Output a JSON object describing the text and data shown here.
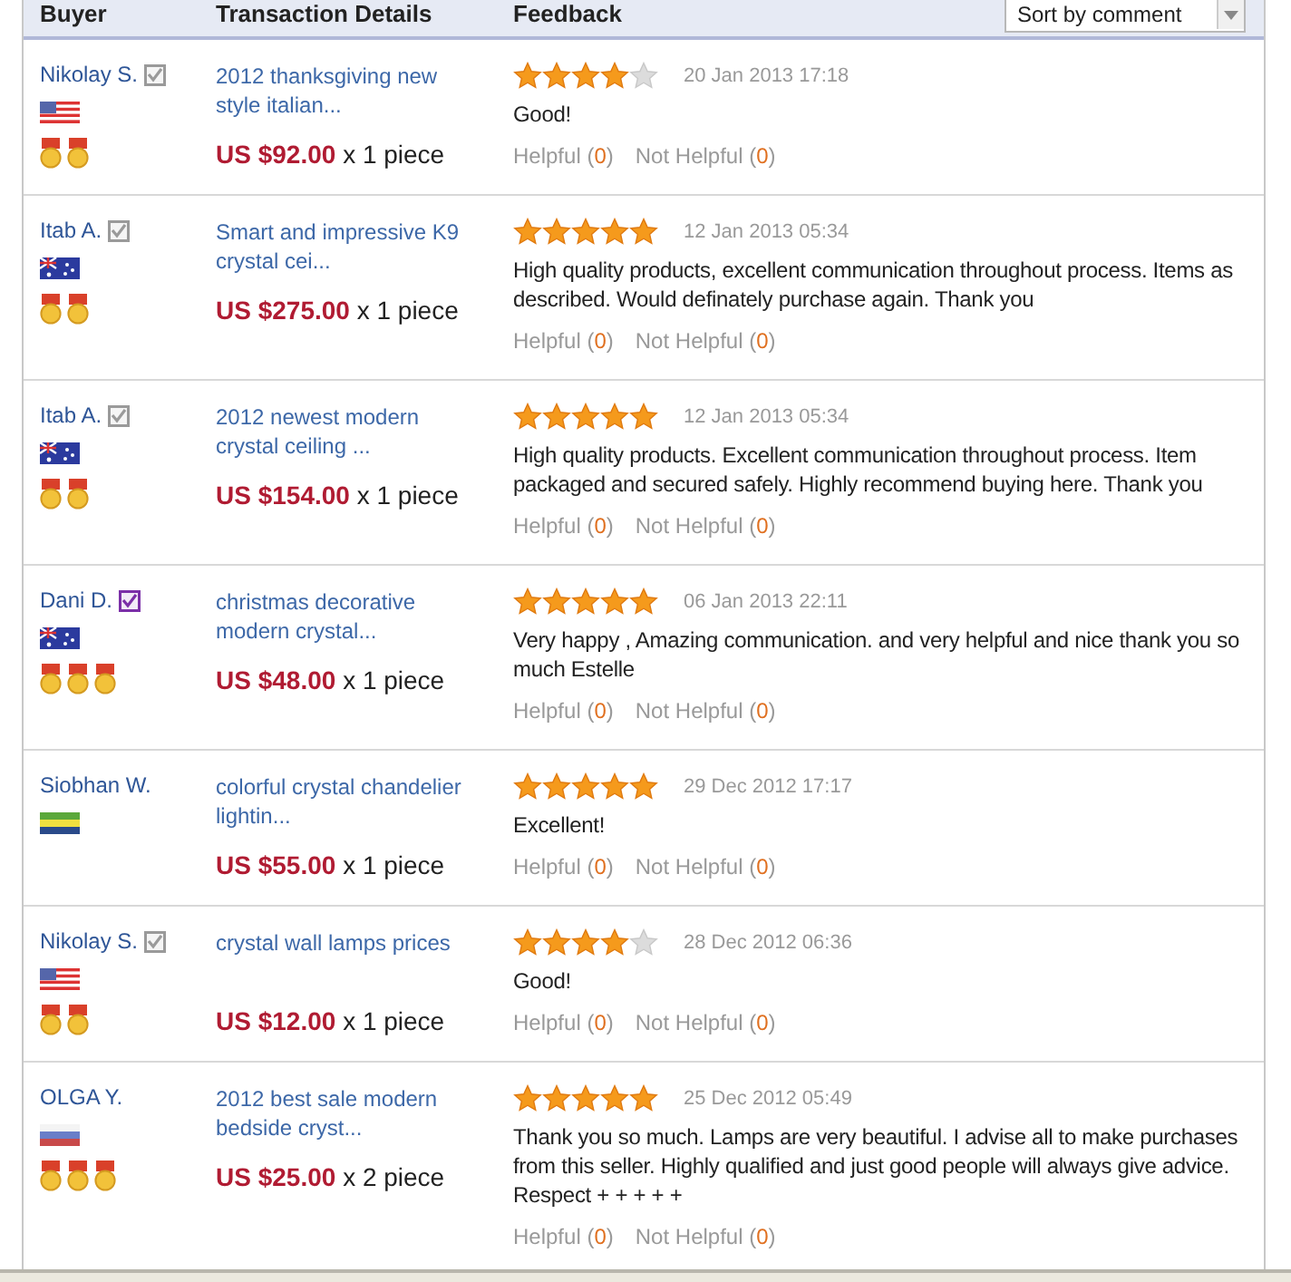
{
  "columns": [
    "Buyer",
    "Transaction Details",
    "Feedback"
  ],
  "sort": {
    "value": "Sort by comment"
  },
  "rows": [
    {
      "buyer": "Nikolay S.",
      "badge": {
        "color": "#9a9a9a"
      },
      "flag": {
        "kind": "us"
      },
      "medals": [
        {
          "kind": "medal"
        },
        {
          "kind": "medal"
        }
      ],
      "product": "2012 thanksgiving new style italian...",
      "price": "US $92.00",
      "quantity": "x 1 piece",
      "stars": 4,
      "date": "20 Jan 2013 17:18",
      "comment": "Good!",
      "helpful": {
        "label": "Helpful",
        "count": "(0)"
      },
      "not_helpful": {
        "label": "Not Helpful",
        "count": "(0)"
      }
    },
    {
      "buyer": "Itab A.",
      "badge": {
        "color": "#9a9a9a"
      },
      "flag": {
        "kind": "au"
      },
      "medals": [
        {
          "kind": "medal"
        },
        {
          "kind": "medal"
        }
      ],
      "product": "Smart and impressive K9 crystal cei...",
      "price": "US $275.00",
      "quantity": "x 1 piece",
      "stars": 5,
      "date": "12 Jan 2013 05:34",
      "comment": "High quality products, excellent communication throughout process. Items as described. Would definately purchase again. Thank you",
      "helpful": {
        "label": "Helpful",
        "count": "(0)"
      },
      "not_helpful": {
        "label": "Not Helpful",
        "count": "(0)"
      }
    },
    {
      "buyer": "Itab A.",
      "badge": {
        "color": "#9a9a9a"
      },
      "flag": {
        "kind": "au"
      },
      "medals": [
        {
          "kind": "medal"
        },
        {
          "kind": "medal"
        }
      ],
      "product": "2012 newest modern crystal ceiling ...",
      "price": "US $154.00",
      "quantity": "x 1 piece",
      "stars": 5,
      "date": "12 Jan 2013 05:34",
      "comment": "High quality products. Excellent communication throughout process. Item packaged and secured safely. Highly recommend buying here. Thank you",
      "helpful": {
        "label": "Helpful",
        "count": "(0)"
      },
      "not_helpful": {
        "label": "Not Helpful",
        "count": "(0)"
      }
    },
    {
      "buyer": "Dani D.",
      "badge": {
        "color": "#7b2fa8"
      },
      "flag": {
        "kind": "au"
      },
      "medals": [
        {
          "kind": "medal"
        },
        {
          "kind": "medal"
        },
        {
          "kind": "medal"
        }
      ],
      "product": "christmas decorative modern crystal...",
      "price": "US $48.00",
      "quantity": "x 1 piece",
      "stars": 5,
      "date": "06 Jan 2013 22:11",
      "comment": "Very happy , Amazing communication. and very helpful and nice thank you so much Estelle",
      "helpful": {
        "label": "Helpful",
        "count": "(0)"
      },
      "not_helpful": {
        "label": "Not Helpful",
        "count": "(0)"
      }
    },
    {
      "buyer": "Siobhan W.",
      "flag": {
        "kind": "ga"
      },
      "product": "colorful crystal chandelier lightin...",
      "price": "US $55.00",
      "quantity": "x 1 piece",
      "stars": 5,
      "date": "29 Dec 2012 17:17",
      "comment": "Excellent!",
      "helpful": {
        "label": "Helpful",
        "count": "(0)"
      },
      "not_helpful": {
        "label": "Not Helpful",
        "count": "(0)"
      }
    },
    {
      "buyer": "Nikolay S.",
      "badge": {
        "color": "#9a9a9a"
      },
      "flag": {
        "kind": "us"
      },
      "medals": [
        {
          "kind": "medal"
        },
        {
          "kind": "medal"
        }
      ],
      "product": "crystal wall lamps prices",
      "price": "US $12.00",
      "quantity": "x 1 piece",
      "stars": 4,
      "date": "28 Dec 2012 06:36",
      "comment": "Good!",
      "helpful": {
        "label": "Helpful",
        "count": "(0)"
      },
      "not_helpful": {
        "label": "Not Helpful",
        "count": "(0)"
      }
    },
    {
      "buyer": "OLGA Y.",
      "flag": {
        "kind": "ru"
      },
      "medals": [
        {
          "kind": "medal"
        },
        {
          "kind": "medal"
        },
        {
          "kind": "medal"
        }
      ],
      "product": "2012 best sale modern bedside cryst...",
      "price": "US $25.00",
      "quantity": "x 2 piece",
      "stars": 5,
      "date": "25 Dec 2012 05:49",
      "comment": "Thank you so much. Lamps are very beautiful. I advise all to make purchases from this seller. Highly qualified and just good people will always give advice. Respect + + + + +",
      "helpful": {
        "label": "Helpful",
        "count": "(0)"
      },
      "not_helpful": {
        "label": "Not Helpful",
        "count": "(0)"
      }
    }
  ]
}
